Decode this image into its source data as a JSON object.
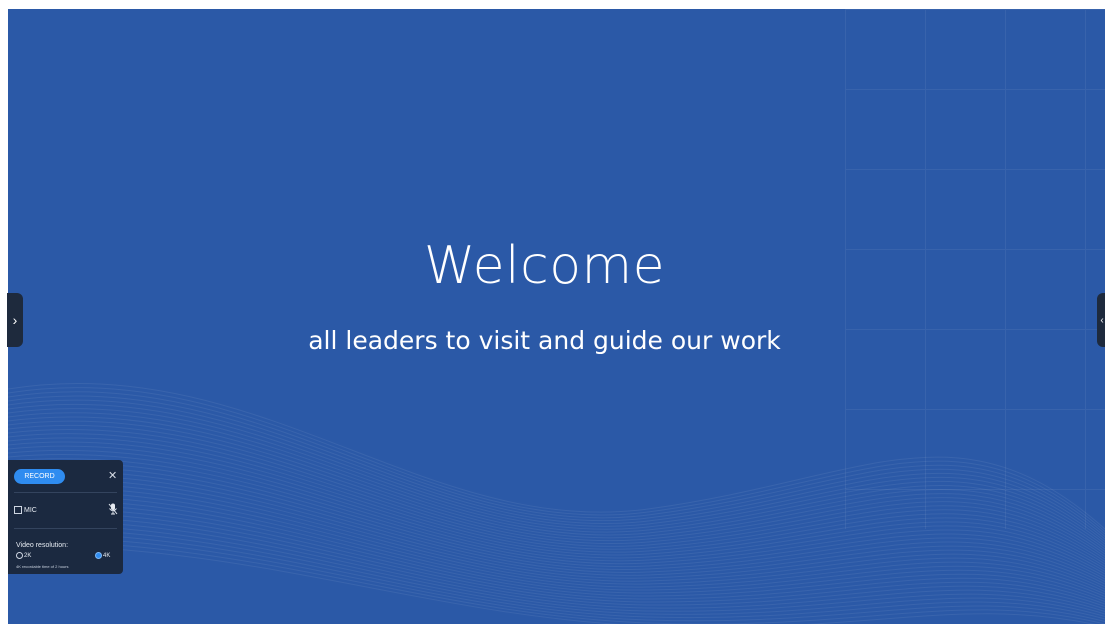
{
  "slide": {
    "title": "Welcome",
    "subtitle": "all leaders to visit and guide our work",
    "background_color": "#2b59a7"
  },
  "side_tabs": {
    "left_icon": "chevron-right-icon",
    "left_glyph": "›",
    "right_icon": "chevron-left-icon",
    "right_glyph": "‹"
  },
  "record_panel": {
    "record_label": "RECORD",
    "close_glyph": "✕",
    "mic_label": "MIC",
    "mic_icon": "mic-muted-icon",
    "resolution_label": "Video resolution:",
    "options": [
      {
        "label": "2K",
        "selected": false
      },
      {
        "label": "4K",
        "selected": true
      }
    ],
    "note": "4K recordable time of 2 hours",
    "accent_color": "#2f8cf0"
  }
}
